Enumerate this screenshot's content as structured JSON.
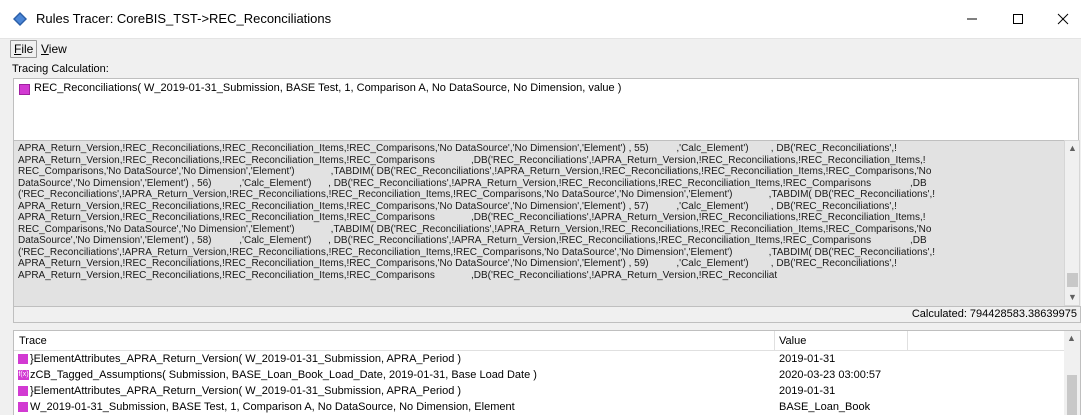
{
  "window": {
    "title": "Rules Tracer: CoreBIS_TST->REC_Reconciliations",
    "minimize_glyph": "—",
    "maximize_glyph": "☐",
    "close_glyph": "✕"
  },
  "menu": {
    "file": {
      "mnemonic": "F",
      "rest": "ile"
    },
    "view": {
      "mnemonic": "V",
      "rest": "iew"
    }
  },
  "tracing": {
    "label": "Tracing Calculation:",
    "calculation": "REC_Reconciliations( W_2019-01-31_Submission, BASE Test, 1, Comparison A, No DataSource, No Dimension, value )"
  },
  "rule_lines": [
    "APRA_Return_Version,!REC_Reconciliations,!REC_Reconciliation_Items,!REC_Comparisons,'No DataSource','No Dimension','Element') , 55)          ,'Calc_Element')        , DB('REC_Reconciliations',!",
    "APRA_Return_Version,!REC_Reconciliations,!REC_Reconciliation_Items,!REC_Comparisons             ,DB('REC_Reconciliations',!APRA_Return_Version,!REC_Reconciliations,!REC_Reconciliation_Items,!",
    "REC_Comparisons,'No DataSource','No Dimension','Element')             ,TABDIM( DB('REC_Reconciliations',!APRA_Return_Version,!REC_Reconciliations,!REC_Reconciliation_Items,!REC_Comparisons,'No",
    "DataSource','No Dimension','Element') , 56)          ,'Calc_Element')      , DB('REC_Reconciliations',!APRA_Return_Version,!REC_Reconciliations,!REC_Reconciliation_Items,!REC_Comparisons              ,DB",
    "('REC_Reconciliations',!APRA_Return_Version,!REC_Reconciliations,!REC_Reconciliation_Items,!REC_Comparisons,'No DataSource','No Dimension','Element')             ,TABDIM( DB('REC_Reconciliations',!",
    "APRA_Return_Version,!REC_Reconciliations,!REC_Reconciliation_Items,!REC_Comparisons,'No DataSource','No Dimension','Element') , 57)          ,'Calc_Element')        , DB('REC_Reconciliations',!",
    "APRA_Return_Version,!REC_Reconciliations,!REC_Reconciliation_Items,!REC_Comparisons             ,DB('REC_Reconciliations',!APRA_Return_Version,!REC_Reconciliations,!REC_Reconciliation_Items,!",
    "REC_Comparisons,'No DataSource','No Dimension','Element')             ,TABDIM( DB('REC_Reconciliations',!APRA_Return_Version,!REC_Reconciliations,!REC_Reconciliation_Items,!REC_Comparisons,'No",
    "DataSource','No Dimension','Element') , 58)          ,'Calc_Element')      , DB('REC_Reconciliations',!APRA_Return_Version,!REC_Reconciliations,!REC_Reconciliation_Items,!REC_Comparisons              ,DB",
    "('REC_Reconciliations',!APRA_Return_Version,!REC_Reconciliations,!REC_Reconciliation_Items,!REC_Comparisons,'No DataSource','No Dimension','Element')             ,TABDIM( DB('REC_Reconciliations',!",
    "APRA_Return_Version,!REC_Reconciliations,!REC_Reconciliation_Items,!REC_Comparisons,'No DataSource','No Dimension','Element') , 59)          ,'Calc_Element')        , DB('REC_Reconciliations',!",
    "APRA_Return_Version,!REC_Reconciliations,!REC_Reconciliation_Items,!REC_Comparisons             ,DB('REC_Reconciliations',!APRA_Return_Version,!REC_Reconciliat"
  ],
  "status": {
    "calculated": "Calculated: 794428583.38639975"
  },
  "trace": {
    "headers": {
      "trace": "Trace",
      "value": "Value"
    },
    "rows": [
      {
        "icon": "rule-icon",
        "text": "}ElementAttributes_APRA_Return_Version( W_2019-01-31_Submission, APRA_Period )",
        "value": "2019-01-31"
      },
      {
        "icon": "function-icon",
        "icon_text": "f(x)",
        "text": "zCB_Tagged_Assumptions( Submission, BASE_Loan_Book_Load_Date, 2019-01-31, Base Load Date )",
        "value": "2020-03-23 03:00:57"
      },
      {
        "icon": "rule-icon",
        "text": "}ElementAttributes_APRA_Return_Version( W_2019-01-31_Submission, APRA_Period )",
        "value": "2019-01-31"
      },
      {
        "icon": "rule-icon",
        "text": "W_2019-01-31_Submission, BASE Test, 1, Comparison A, No DataSource, No Dimension, Element",
        "value": "BASE_Loan_Book"
      }
    ]
  },
  "colors": {
    "icon_magenta": "#d23ad2",
    "rule_bg": "#e2e2e2",
    "window_bg": "#f0f0f0"
  }
}
